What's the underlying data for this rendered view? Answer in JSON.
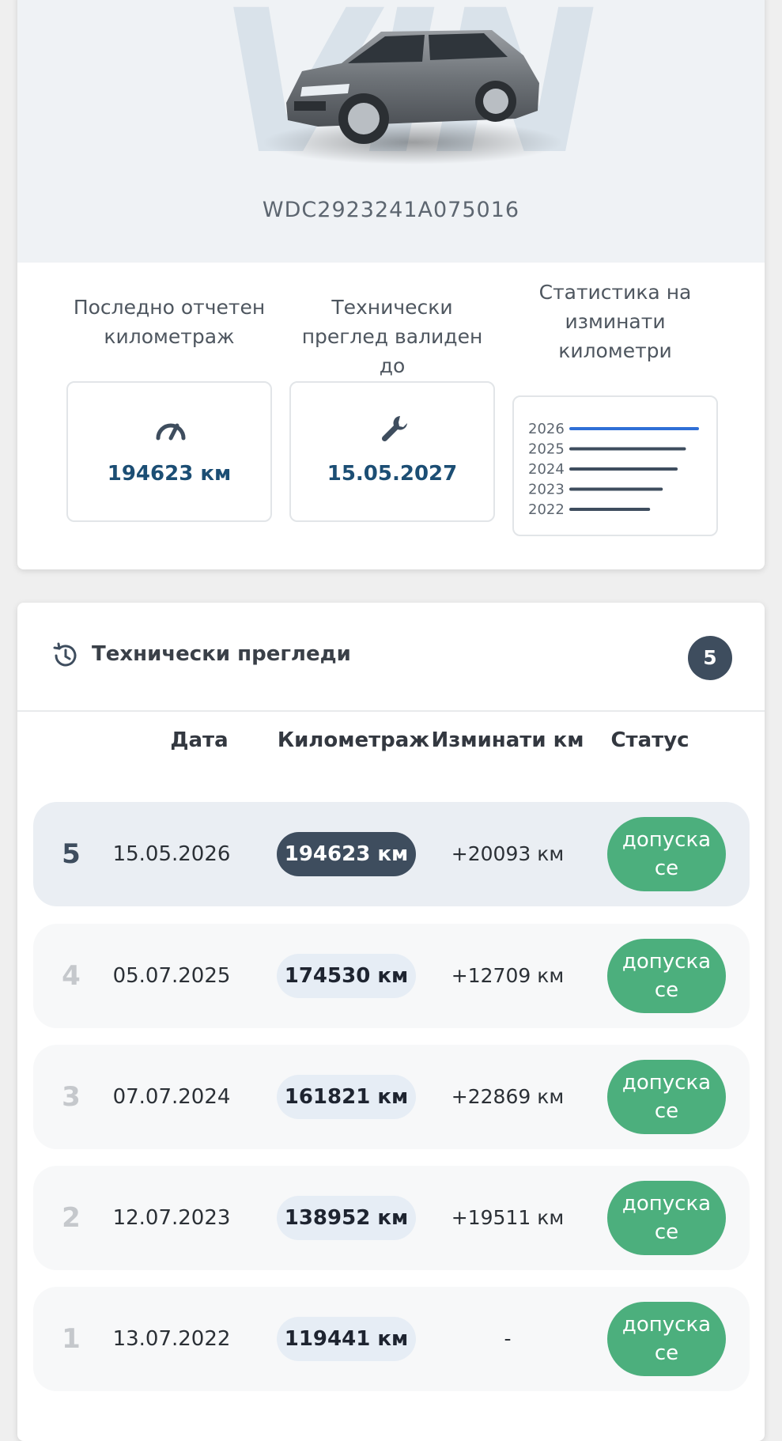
{
  "vehicle": {
    "watermark": "VIN",
    "vin": "WDC2923241A075016"
  },
  "stats": {
    "mileage": {
      "label": "Последно отчетен километраж",
      "value": "194623 км",
      "icon": "speedometer-icon"
    },
    "inspection": {
      "label": "Технически преглед валиден до",
      "value": "15.05.2027",
      "icon": "wrench-icon"
    },
    "chart": {
      "label": "Статистика на изминати километри",
      "chart_data": {
        "type": "bar",
        "orientation": "horizontal",
        "categories": [
          "2026",
          "2025",
          "2024",
          "2023",
          "2022"
        ],
        "values": [
          194623,
          174530,
          161821,
          138952,
          119441
        ],
        "highlight": "2026",
        "colors": {
          "highlight": "#2f6fd6",
          "default": "#3e4d5e"
        }
      }
    }
  },
  "inspections": {
    "title": "Технически прегледи",
    "count": "5",
    "headers": {
      "date": "Дата",
      "mileage": "Километраж",
      "delta": "Изминати км",
      "status": "Статус"
    },
    "rows": [
      {
        "index": "5",
        "date": "15.05.2026",
        "mileage": "194623 км",
        "delta": "+20093 км",
        "status": "допуска се",
        "active": true
      },
      {
        "index": "4",
        "date": "05.07.2025",
        "mileage": "174530 км",
        "delta": "+12709 км",
        "status": "допуска се",
        "active": false
      },
      {
        "index": "3",
        "date": "07.07.2024",
        "mileage": "161821 км",
        "delta": "+22869 км",
        "status": "допуска се",
        "active": false
      },
      {
        "index": "2",
        "date": "12.07.2023",
        "mileage": "138952 км",
        "delta": "+19511 км",
        "status": "допуска се",
        "active": false
      },
      {
        "index": "1",
        "date": "13.07.2022",
        "mileage": "119441 км",
        "delta": "-",
        "status": "допуска се",
        "active": false
      }
    ]
  },
  "colors": {
    "accent": "#1c4e74",
    "badge": "#3e4d5e",
    "status_ok": "#4caf7d"
  }
}
